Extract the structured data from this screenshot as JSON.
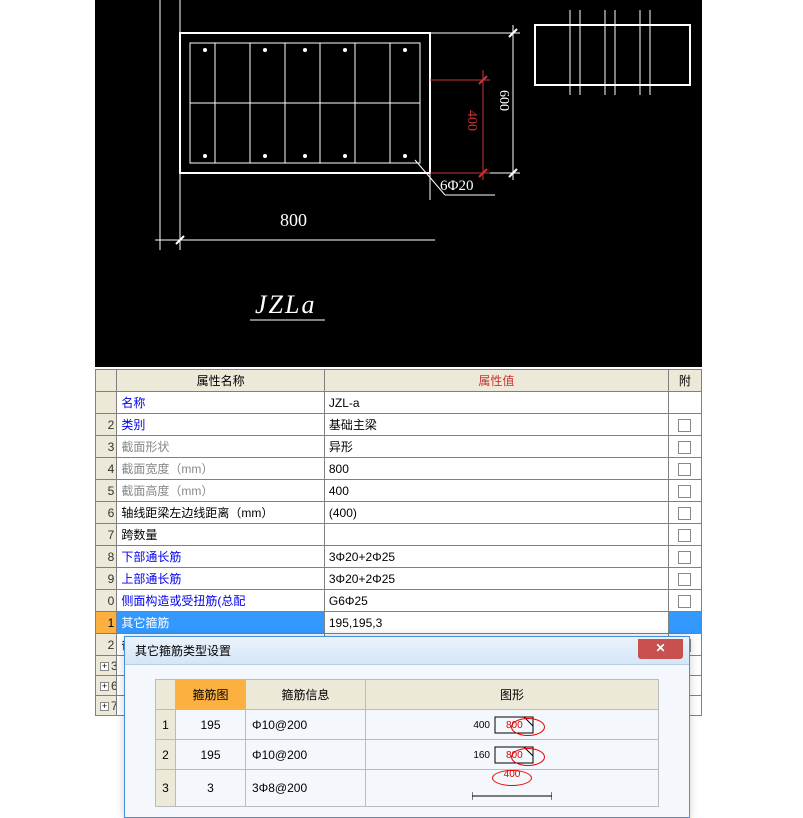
{
  "cad": {
    "label_jzla": "JZLa",
    "dim_800": "800",
    "dim_400": "400",
    "dim_600": "600",
    "rebar_6d20": "6Φ20"
  },
  "props": {
    "header_name": "属性名称",
    "header_val": "属性值",
    "header_att": "附",
    "rows": [
      {
        "n": " ",
        "name": "名称",
        "val": "JZL-a",
        "link": true,
        "chk": false
      },
      {
        "n": "2",
        "name": "类别",
        "val": "基础主梁",
        "link": true,
        "chk": true
      },
      {
        "n": "3",
        "name": "截面形状",
        "val": "异形",
        "link": false,
        "gray": true,
        "chk": true
      },
      {
        "n": "4",
        "name": "截面宽度（mm）",
        "val": "800",
        "link": false,
        "gray": true,
        "chk": true
      },
      {
        "n": "5",
        "name": "截面高度（mm）",
        "val": "400",
        "link": false,
        "gray": true,
        "chk": true
      },
      {
        "n": "6",
        "name": "轴线距梁左边线距离（mm）",
        "val": "(400)",
        "link": false,
        "chk": true
      },
      {
        "n": "7",
        "name": "跨数量",
        "val": "",
        "link": false,
        "chk": true
      },
      {
        "n": "8",
        "name": "下部通长筋",
        "val": "3Φ20+2Φ25",
        "link": true,
        "chk": true
      },
      {
        "n": "9",
        "name": "上部通长筋",
        "val": "3Φ20+2Φ25",
        "link": true,
        "chk": true
      },
      {
        "n": "0",
        "name": "侧面构造或受扭筋(总配",
        "val": "G6Φ25",
        "link": true,
        "chk": true
      },
      {
        "n": "1",
        "name": "其它箍筋",
        "val": "195,195,3",
        "link": true,
        "chk": false,
        "sel": true
      },
      {
        "n": "2",
        "name": "备注",
        "val": "",
        "link": false,
        "chk": true
      },
      {
        "n": "3",
        "name": "",
        "val": "",
        "exp": true
      },
      {
        "n": "6",
        "name": "",
        "val": "",
        "exp": true
      },
      {
        "n": "7",
        "name": "",
        "val": "",
        "exp": true
      }
    ]
  },
  "dialog": {
    "title": "其它箍筋类型设置",
    "headers": {
      "img": "箍筋图",
      "info": "箍筋信息",
      "shape": "图形"
    },
    "rows": [
      {
        "n": "1",
        "img": "195",
        "info": "Φ10@200",
        "d1": "400",
        "d2": "800",
        "type": "rect"
      },
      {
        "n": "2",
        "img": "195",
        "info": "Φ10@200",
        "d1": "160",
        "d2": "800",
        "type": "rect"
      },
      {
        "n": "3",
        "img": "3",
        "info": "3Φ8@200",
        "d1": "400",
        "d2": "",
        "type": "line"
      }
    ]
  }
}
